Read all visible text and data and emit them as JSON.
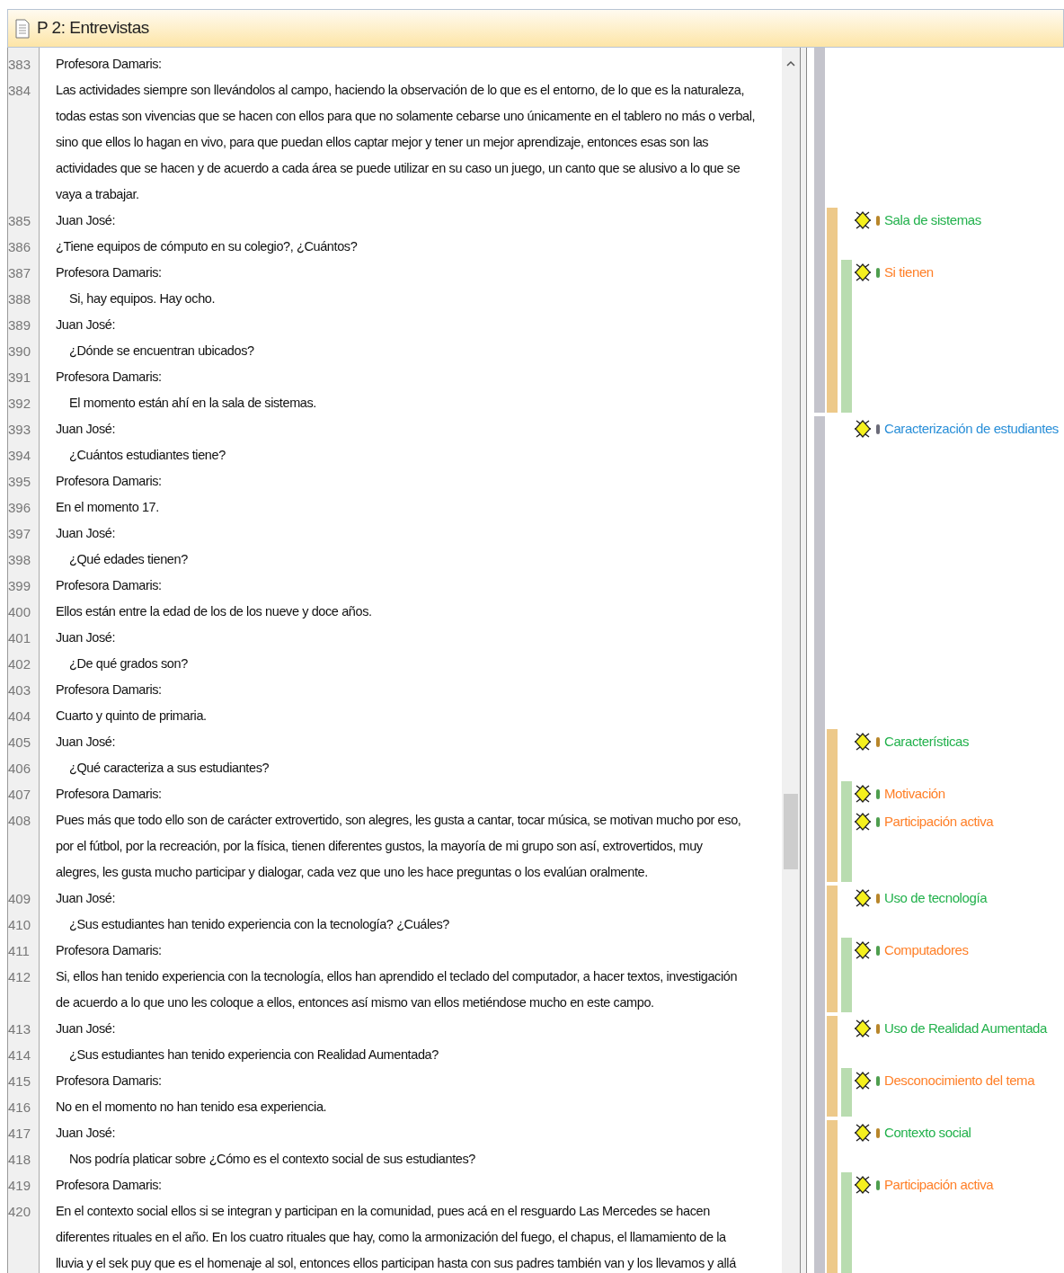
{
  "document": {
    "title": "P 2: Entrevistas"
  },
  "paragraphs": [
    {
      "number": "383",
      "indented": false,
      "lines": [
        "Profesora Damaris:"
      ]
    },
    {
      "number": "384",
      "indented": false,
      "lines": [
        "Las actividades siempre son llevándolos al campo, haciendo la observación de lo que es el entorno, de lo que es la naturaleza,",
        "todas estas son vivencias que se hacen con ellos para que no solamente cebarse uno únicamente en el tablero no más o verbal,",
        "sino que ellos lo hagan en vivo, para que puedan ellos captar mejor y tener un mejor aprendizaje, entonces esas son las",
        "actividades que se hacen y de acuerdo a cada área se puede utilizar en su caso un juego, un canto que se alusivo a lo que se",
        "vaya a trabajar."
      ]
    },
    {
      "number": "385",
      "indented": false,
      "lines": [
        "Juan José:"
      ],
      "codes": [
        {
          "kind": "category",
          "label": "Sala de sistemas"
        }
      ]
    },
    {
      "number": "386",
      "indented": false,
      "lines": [
        "¿Tiene equipos de cómputo en su colegio?, ¿Cuántos?"
      ]
    },
    {
      "number": "387",
      "indented": false,
      "lines": [
        "Profesora Damaris:"
      ],
      "codes": [
        {
          "kind": "subcode",
          "label": "Si tienen"
        }
      ]
    },
    {
      "number": "388",
      "indented": true,
      "lines": [
        "Si, hay equipos. Hay ocho."
      ]
    },
    {
      "number": "389",
      "indented": false,
      "lines": [
        "Juan José:"
      ]
    },
    {
      "number": "390",
      "indented": true,
      "lines": [
        "¿Dónde se encuentran ubicados?"
      ]
    },
    {
      "number": "391",
      "indented": false,
      "lines": [
        "Profesora Damaris:"
      ]
    },
    {
      "number": "392",
      "indented": true,
      "lines": [
        "El momento están ahí en la sala de sistemas."
      ]
    },
    {
      "number": "393",
      "indented": false,
      "lines": [
        "Juan José:"
      ],
      "codes": [
        {
          "kind": "group",
          "label": "Caracterización de estudiantes"
        }
      ]
    },
    {
      "number": "394",
      "indented": true,
      "lines": [
        "¿Cuántos estudiantes tiene?"
      ]
    },
    {
      "number": "395",
      "indented": false,
      "lines": [
        "Profesora Damaris:"
      ]
    },
    {
      "number": "396",
      "indented": false,
      "lines": [
        "En el momento 17."
      ]
    },
    {
      "number": "397",
      "indented": false,
      "lines": [
        "Juan José:"
      ]
    },
    {
      "number": "398",
      "indented": true,
      "lines": [
        "¿Qué edades tienen?"
      ]
    },
    {
      "number": "399",
      "indented": false,
      "lines": [
        "Profesora Damaris:"
      ]
    },
    {
      "number": "400",
      "indented": false,
      "lines": [
        "Ellos están entre la edad de los de los nueve y doce años."
      ]
    },
    {
      "number": "401",
      "indented": false,
      "lines": [
        "Juan José:"
      ]
    },
    {
      "number": "402",
      "indented": true,
      "lines": [
        "¿De qué grados son?"
      ]
    },
    {
      "number": "403",
      "indented": false,
      "lines": [
        "Profesora Damaris:"
      ]
    },
    {
      "number": "404",
      "indented": false,
      "lines": [
        "Cuarto y quinto de primaria."
      ]
    },
    {
      "number": "405",
      "indented": false,
      "lines": [
        "Juan José:"
      ],
      "codes": [
        {
          "kind": "category",
          "label": "Características"
        }
      ]
    },
    {
      "number": "406",
      "indented": true,
      "lines": [
        "¿Qué caracteriza a sus estudiantes?"
      ]
    },
    {
      "number": "407",
      "indented": false,
      "lines": [
        "Profesora Damaris:"
      ],
      "codes": [
        {
          "kind": "subcode",
          "label": "Motivación"
        },
        {
          "kind": "subcode",
          "label": "Participación activa"
        }
      ]
    },
    {
      "number": "408",
      "indented": false,
      "lines": [
        "Pues más que todo ello son de carácter extrovertido, son alegres, les gusta a cantar, tocar música, se motivan mucho por eso,",
        "por el fútbol, por la recreación, por la física, tienen diferentes gustos, la mayoría de mi grupo son así, extrovertidos, muy",
        "alegres, les gusta mucho participar y dialogar, cada vez que uno les hace preguntas o los evalúan oralmente."
      ]
    },
    {
      "number": "409",
      "indented": false,
      "lines": [
        "Juan José:"
      ],
      "codes": [
        {
          "kind": "category",
          "label": "Uso de tecnología"
        }
      ]
    },
    {
      "number": "410",
      "indented": true,
      "lines": [
        "¿Sus estudiantes han tenido experiencia con la tecnología? ¿Cuáles?"
      ]
    },
    {
      "number": "411",
      "indented": false,
      "lines": [
        "Profesora Damaris:"
      ],
      "codes": [
        {
          "kind": "subcode",
          "label": "Computadores"
        }
      ]
    },
    {
      "number": "412",
      "indented": false,
      "lines": [
        "Si, ellos han tenido experiencia con la tecnología, ellos han aprendido el teclado del computador, a hacer textos, investigación",
        "de acuerdo a lo que uno les coloque a ellos, entonces así mismo van ellos metiéndose mucho en este campo."
      ]
    },
    {
      "number": "413",
      "indented": false,
      "lines": [
        "Juan José:"
      ],
      "codes": [
        {
          "kind": "category",
          "label": "Uso de Realidad Aumentada"
        }
      ]
    },
    {
      "number": "414",
      "indented": true,
      "lines": [
        "¿Sus estudiantes han tenido experiencia con Realidad Aumentada?"
      ]
    },
    {
      "number": "415",
      "indented": false,
      "lines": [
        "Profesora Damaris:"
      ],
      "codes": [
        {
          "kind": "subcode",
          "label": "Desconocimiento del tema"
        }
      ]
    },
    {
      "number": "416",
      "indented": false,
      "lines": [
        "No en el momento no han tenido esa experiencia."
      ]
    },
    {
      "number": "417",
      "indented": false,
      "lines": [
        "Juan José:"
      ],
      "codes": [
        {
          "kind": "category",
          "label": "Contexto social"
        }
      ]
    },
    {
      "number": "418",
      "indented": true,
      "lines": [
        "Nos podría platicar sobre ¿Cómo es el contexto social de sus estudiantes?"
      ]
    },
    {
      "number": "419",
      "indented": false,
      "lines": [
        "Profesora Damaris:"
      ],
      "codes": [
        {
          "kind": "subcode",
          "label": "Participación activa"
        }
      ]
    },
    {
      "number": "420",
      "indented": false,
      "lines": [
        "En el contexto social ellos si se integran y participan en la comunidad, pues acá en el resguardo Las Mercedes se hacen",
        "diferentes rituales en el año. En los cuatro rituales que hay, como la armonización del fuego, el chapus, el llamamiento de la",
        "lluvia y el sek puy que es el homenaje al sol, entonces ellos participan hasta con sus padres también van y los llevamos y allá"
      ]
    }
  ]
}
